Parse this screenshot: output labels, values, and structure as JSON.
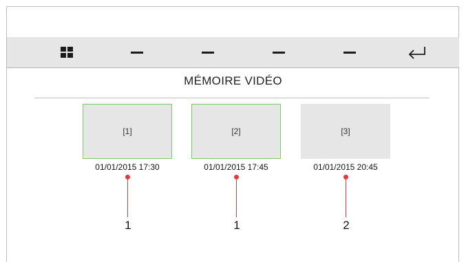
{
  "toolbar": {
    "items": [
      {
        "icon": "grid-icon"
      },
      {
        "icon": "dash-icon"
      },
      {
        "icon": "dash-icon"
      },
      {
        "icon": "dash-icon"
      },
      {
        "icon": "dash-icon"
      },
      {
        "icon": "enter-return-icon"
      }
    ]
  },
  "page": {
    "title": "MÉMOIRE VIDÉO"
  },
  "videos": [
    {
      "label": "[1]",
      "timestamp": "01/01/2015 17:30",
      "selected": true
    },
    {
      "label": "[2]",
      "timestamp": "01/01/2015 17:45",
      "selected": true
    },
    {
      "label": "[3]",
      "timestamp": "01/01/2015 20:45",
      "selected": false
    }
  ],
  "callouts": [
    "1",
    "1",
    "2"
  ],
  "colors": {
    "toolbar_bg": "#e6e6e6",
    "thumb_bg": "#e6e6e6",
    "selected_border": "#7dc66a",
    "callout": "#e23b3b"
  }
}
